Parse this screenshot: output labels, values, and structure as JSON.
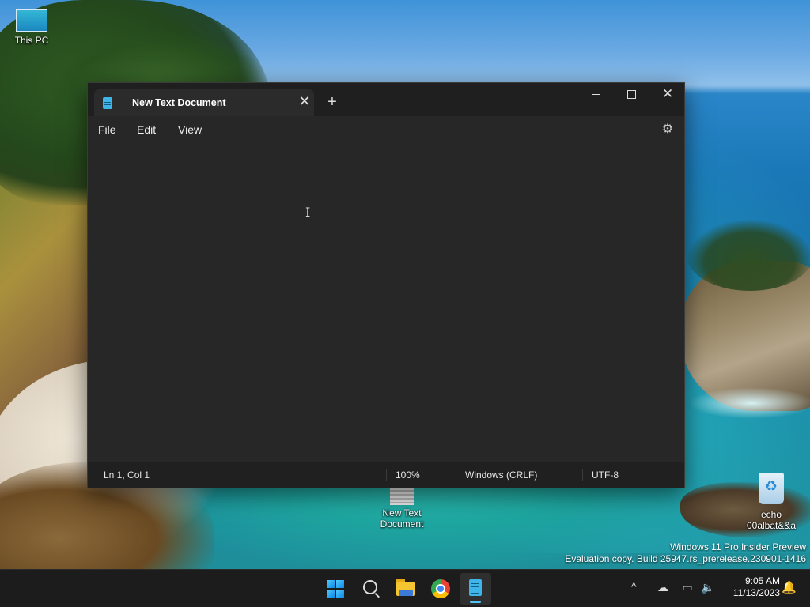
{
  "desktop": {
    "icons": [
      {
        "label": "This PC"
      },
      {
        "label_line1": "New Text",
        "label_line2": "Document"
      },
      {
        "label_line1": "echo",
        "label_line2": "00albat&&a"
      }
    ],
    "watermark": {
      "line1": "Windows 11 Pro Insider Preview",
      "line2": "Evaluation copy. Build 25947.rs_prerelease.230901-1416"
    }
  },
  "notepad": {
    "tab_title": "New Text Document",
    "tab_close": "✕",
    "new_tab": "+",
    "caption": {
      "minimize": "Minimize",
      "maximize": "Maximize",
      "close": "✕"
    },
    "menu": {
      "file": "File",
      "edit": "Edit",
      "view": "View"
    },
    "settings_icon": "⚙",
    "editor_content": "",
    "status": {
      "position": "Ln 1, Col 1",
      "zoom": "100%",
      "line_ending": "Windows (CRLF)",
      "encoding": "UTF-8"
    }
  },
  "taskbar": {
    "apps": [
      "start",
      "search",
      "file-explorer",
      "chrome",
      "notepad"
    ],
    "active_app": "notepad",
    "tray_chevron": "^",
    "clock": {
      "time": "9:05 AM",
      "date": "11/13/2023"
    }
  },
  "colors": {
    "window_bg": "#272727",
    "titlebar_bg": "#1f1f1f",
    "statusbar_bg": "#202020",
    "taskbar_bg": "#1c1c1c",
    "accent": "#4fc3f7"
  }
}
